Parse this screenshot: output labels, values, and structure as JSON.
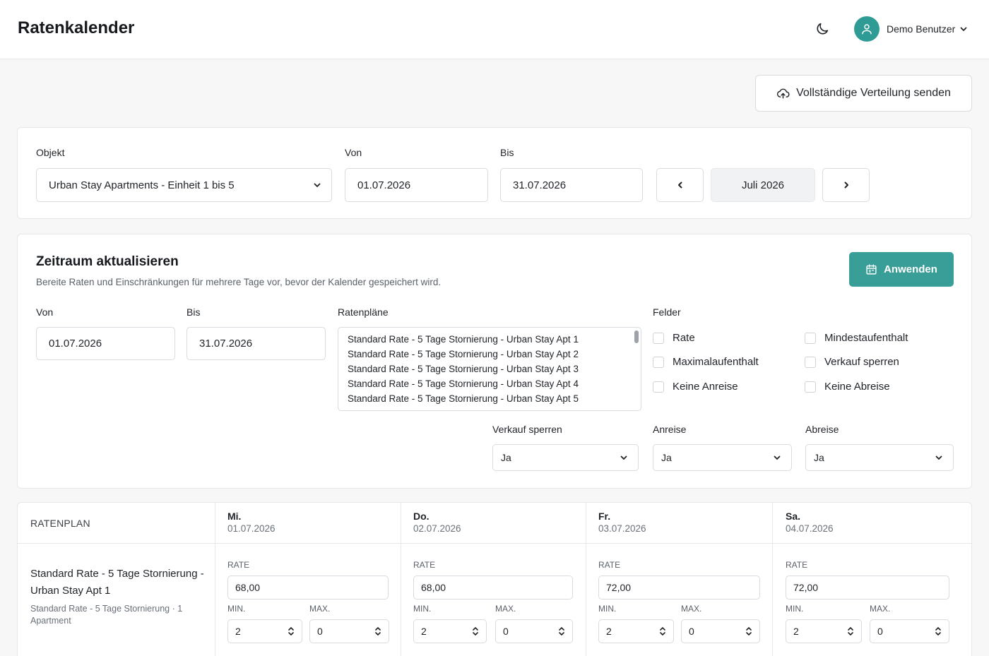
{
  "header": {
    "title": "Ratenkalender",
    "theme_icon": "moon-icon",
    "user": {
      "name": "Demo Benutzer",
      "avatar_icon": "user-icon",
      "accent": "#2f9b95"
    }
  },
  "actions": {
    "send_label": "Vollständige Verteilung senden",
    "send_icon": "cloud-upload-icon"
  },
  "filter": {
    "object_label": "Objekt",
    "object_value": "Urban Stay Apartments - Einheit 1 bis 5",
    "from_label": "Von",
    "from_value": "01.07.2026",
    "to_label": "Bis",
    "to_value": "31.07.2026",
    "month": "Juli 2026"
  },
  "update": {
    "title": "Zeitraum aktualisieren",
    "subtitle": "Bereite Raten und Einschränkungen für mehrere Tage vor, bevor der Kalender gespeichert wird.",
    "apply_label": "Anwenden",
    "apply_color": "#3a9e98",
    "from_label": "Von",
    "from_value": "01.07.2026",
    "to_label": "Bis",
    "to_value": "31.07.2026",
    "plans_label": "Ratenpläne",
    "plans": [
      "Standard Rate - 5 Tage Stornierung - Urban Stay Apt 1",
      "Standard Rate - 5 Tage Stornierung - Urban Stay Apt 2",
      "Standard Rate - 5 Tage Stornierung - Urban Stay Apt 3",
      "Standard Rate - 5 Tage Stornierung - Urban Stay Apt 4",
      "Standard Rate - 5 Tage Stornierung - Urban Stay Apt 5"
    ],
    "fields_label": "Felder",
    "fields": [
      "Rate",
      "Mindestaufenthalt",
      "Maximalaufenthalt",
      "Verkauf sperren",
      "Keine Anreise",
      "Keine Abreise"
    ],
    "stop_sell_label": "Verkauf sperren",
    "stop_sell_value": "Ja",
    "arrival_label": "Anreise",
    "arrival_value": "Ja",
    "departure_label": "Abreise",
    "departure_value": "Ja"
  },
  "table": {
    "plan_header": "RATENPLAN",
    "plan_name": "Standard Rate - 5 Tage Stornierung - Urban Stay Apt 1",
    "plan_meta": "Standard Rate - 5 Tage Stornierung · 1 Apartment",
    "rate_label": "RATE",
    "min_label": "MIN.",
    "max_label": "MAX.",
    "days": [
      {
        "name": "Mi.",
        "date": "01.07.2026",
        "rate": "68,00",
        "min": "2",
        "max": "0"
      },
      {
        "name": "Do.",
        "date": "02.07.2026",
        "rate": "68,00",
        "min": "2",
        "max": "0"
      },
      {
        "name": "Fr.",
        "date": "03.07.2026",
        "rate": "72,00",
        "min": "2",
        "max": "0"
      },
      {
        "name": "Sa.",
        "date": "04.07.2026",
        "rate": "72,00",
        "min": "2",
        "max": "0"
      }
    ]
  }
}
